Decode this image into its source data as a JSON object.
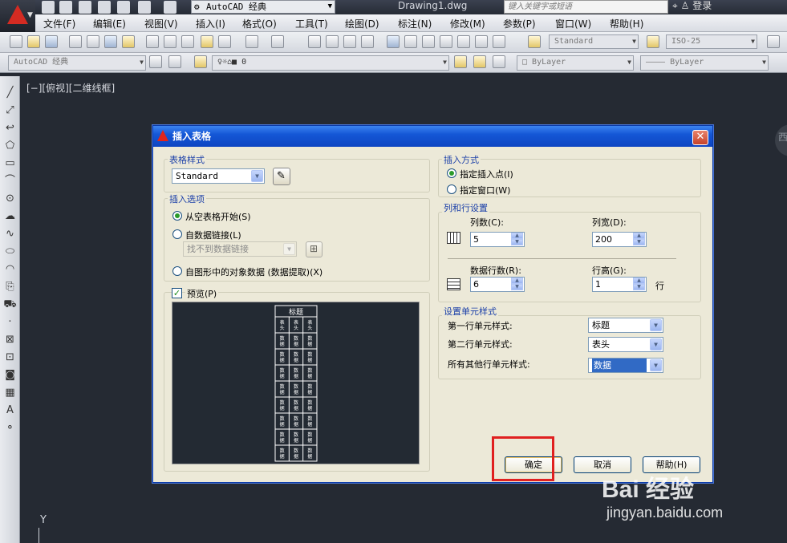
{
  "app": {
    "workspace": "AutoCAD 经典",
    "doc_title": "Drawing1.dwg",
    "search_placeholder": "键入关键字或短语",
    "login": "登录"
  },
  "menu": [
    "文件(F)",
    "编辑(E)",
    "视图(V)",
    "插入(I)",
    "格式(O)",
    "工具(T)",
    "绘图(D)",
    "标注(N)",
    "修改(M)",
    "参数(P)",
    "窗口(W)",
    "帮助(H)"
  ],
  "toolbar1": {
    "text_style": "Standard",
    "dim_style": "ISO-25"
  },
  "toolbar2": {
    "workspace": "AutoCAD 经典",
    "layer": "0",
    "color": "ByLayer",
    "linetype": "ByLayer"
  },
  "canvas": {
    "view_label": "[−][俯视][二维线框]",
    "ucs_y": "Y",
    "viewcube": "西"
  },
  "dialog": {
    "title": "插入表格",
    "close": "✕",
    "table_style": {
      "group": "表格样式",
      "value": "Standard"
    },
    "insert_options": {
      "group": "插入选项",
      "empty": "从空表格开始(S)",
      "from_link": "自数据链接(L)",
      "link_placeholder": "找不到数据链接",
      "from_objects": "自图形中的对象数据 (数据提取)(X)"
    },
    "preview": {
      "label": "预览(P)",
      "title": "标题",
      "header": "表头",
      "data": "数据"
    },
    "insert_method": {
      "group": "插入方式",
      "point": "指定插入点(I)",
      "window": "指定窗口(W)"
    },
    "rows_cols": {
      "group": "列和行设置",
      "columns_label": "列数(C):",
      "columns": "5",
      "col_width_label": "列宽(D):",
      "col_width": "200",
      "rows_label": "数据行数(R):",
      "rows": "6",
      "row_height_label": "行高(G):",
      "row_height": "1",
      "row_unit": "行"
    },
    "cell_styles": {
      "group": "设置单元样式",
      "first_label": "第一行单元样式:",
      "first": "标题",
      "second_label": "第二行单元样式:",
      "second": "表头",
      "other_label": "所有其他行单元样式:",
      "other": "数据"
    },
    "buttons": {
      "ok": "确定",
      "cancel": "取消",
      "help": "帮助(H)"
    }
  },
  "watermark": {
    "brand": "Bai 经验",
    "url": "jingyan.baidu.com"
  }
}
